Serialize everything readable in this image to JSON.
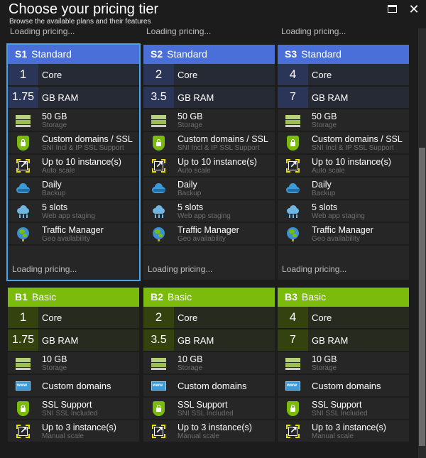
{
  "window": {
    "title": "Choose your pricing tier",
    "subtitle": "Browse the available plans and their features",
    "maximize_icon": "maximize-icon",
    "close_icon": "close-icon",
    "close_glyph": "✕"
  },
  "loading_text": "Loading pricing...",
  "colors": {
    "standard": "#4a6fd8",
    "basic": "#7bbb0c",
    "selected_outline": "#4aa3e8"
  },
  "standard_tiers": [
    {
      "code": "S1",
      "name": "Standard",
      "selected": true,
      "cores": "1",
      "cores_label": "Core",
      "ram": "1.75",
      "ram_label": "GB RAM",
      "storage": "50 GB",
      "storage_sub": "Storage",
      "domains": "Custom domains / SSL",
      "domains_sub": "SNI Incl & IP SSL Support",
      "scale": "Up to 10 instance(s)",
      "scale_sub": "Auto scale",
      "backup": "Daily",
      "backup_sub": "Backup",
      "slots": "5 slots",
      "slots_sub": "Web app staging",
      "traffic": "Traffic Manager",
      "traffic_sub": "Geo availability",
      "loading": "Loading pricing..."
    },
    {
      "code": "S2",
      "name": "Standard",
      "selected": false,
      "cores": "2",
      "cores_label": "Core",
      "ram": "3.5",
      "ram_label": "GB RAM",
      "storage": "50 GB",
      "storage_sub": "Storage",
      "domains": "Custom domains / SSL",
      "domains_sub": "SNI Incl & IP SSL Support",
      "scale": "Up to 10 instance(s)",
      "scale_sub": "Auto scale",
      "backup": "Daily",
      "backup_sub": "Backup",
      "slots": "5 slots",
      "slots_sub": "Web app staging",
      "traffic": "Traffic Manager",
      "traffic_sub": "Geo availability",
      "loading": "Loading pricing..."
    },
    {
      "code": "S3",
      "name": "Standard",
      "selected": false,
      "cores": "4",
      "cores_label": "Core",
      "ram": "7",
      "ram_label": "GB RAM",
      "storage": "50 GB",
      "storage_sub": "Storage",
      "domains": "Custom domains / SSL",
      "domains_sub": "SNI Incl & IP SSL Support",
      "scale": "Up to 10 instance(s)",
      "scale_sub": "Auto scale",
      "backup": "Daily",
      "backup_sub": "Backup",
      "slots": "5 slots",
      "slots_sub": "Web app staging",
      "traffic": "Traffic Manager",
      "traffic_sub": "Geo availability",
      "loading": "Loading pricing..."
    }
  ],
  "basic_tiers": [
    {
      "code": "B1",
      "name": "Basic",
      "cores": "1",
      "cores_label": "Core",
      "ram": "1.75",
      "ram_label": "GB RAM",
      "storage": "10 GB",
      "storage_sub": "Storage",
      "domains": "Custom domains",
      "ssl": "SSL Support",
      "ssl_sub": "SNI SSL Included",
      "scale": "Up to 3 instance(s)",
      "scale_sub": "Manual scale"
    },
    {
      "code": "B2",
      "name": "Basic",
      "cores": "2",
      "cores_label": "Core",
      "ram": "3.5",
      "ram_label": "GB RAM",
      "storage": "10 GB",
      "storage_sub": "Storage",
      "domains": "Custom domains",
      "ssl": "SSL Support",
      "ssl_sub": "SNI SSL Included",
      "scale": "Up to 3 instance(s)",
      "scale_sub": "Manual scale"
    },
    {
      "code": "B3",
      "name": "Basic",
      "cores": "4",
      "cores_label": "Core",
      "ram": "7",
      "ram_label": "GB RAM",
      "storage": "10 GB",
      "storage_sub": "Storage",
      "domains": "Custom domains",
      "ssl": "SSL Support",
      "ssl_sub": "SNI SSL Included",
      "scale": "Up to 3 instance(s)",
      "scale_sub": "Manual scale"
    }
  ]
}
